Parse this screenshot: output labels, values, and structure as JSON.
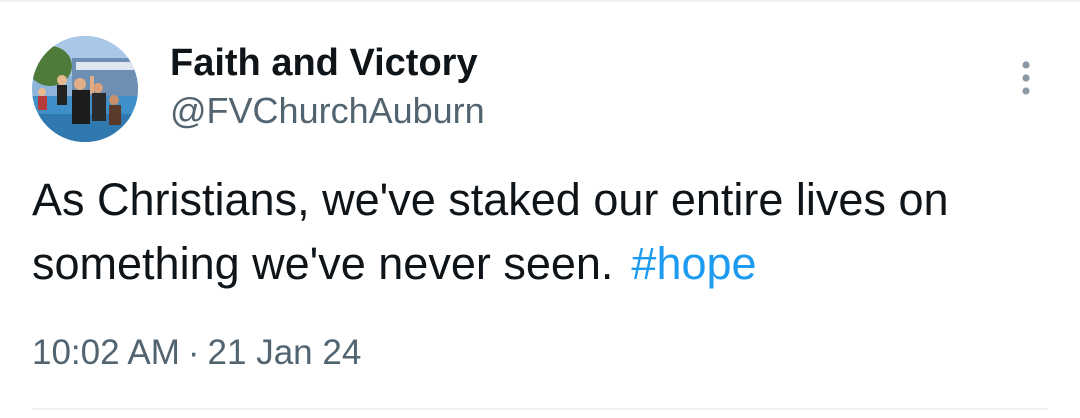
{
  "tweet": {
    "author": {
      "display_name": "Faith and Victory",
      "handle": "@FVChurchAuburn",
      "avatar_icon": "profile-photo"
    },
    "text": "As Christians, we've staked our entire lives on something we've never seen.",
    "hashtag": "#hope",
    "time": "10:02 AM",
    "separator": "·",
    "date": "21 Jan 24",
    "more_icon": "more-vertical-icon"
  },
  "colors": {
    "text": "#0f1419",
    "secondary": "#536471",
    "link": "#1d9bf0",
    "divider": "#eff3f4",
    "background": "#ffffff"
  }
}
